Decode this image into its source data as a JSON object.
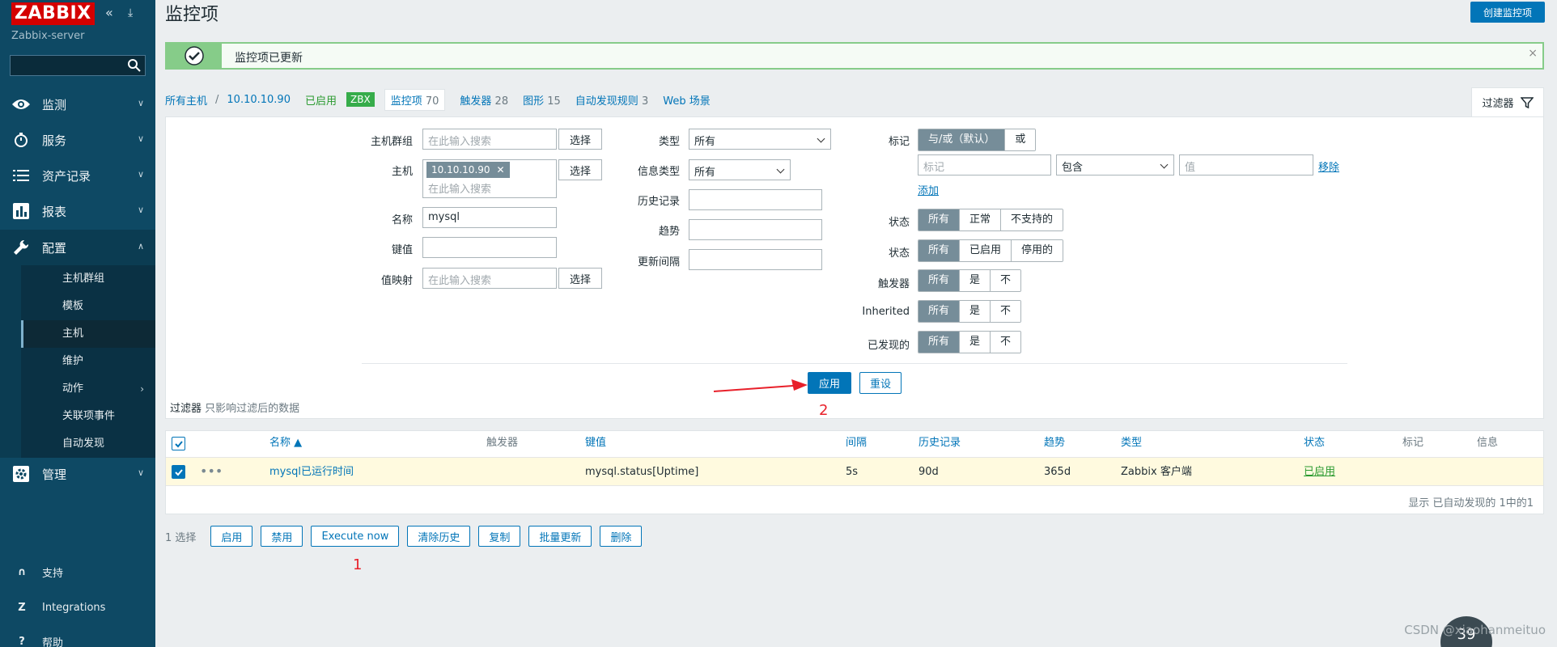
{
  "sidebar": {
    "logo": "ZABBIX",
    "server": "Zabbix-server",
    "search_placeholder": "",
    "nav": [
      {
        "label": "监测",
        "icon": "eye-icon"
      },
      {
        "label": "服务",
        "icon": "clock-icon"
      },
      {
        "label": "资产记录",
        "icon": "list-icon"
      },
      {
        "label": "报表",
        "icon": "chart-icon"
      },
      {
        "label": "配置",
        "icon": "wrench-icon"
      },
      {
        "label": "管理",
        "icon": "gear-icon"
      }
    ],
    "sub": [
      "主机群组",
      "模板",
      "主机",
      "维护",
      "动作",
      "关联项事件",
      "自动发现"
    ],
    "bottom": [
      {
        "label": "支持",
        "icon": "headset-icon"
      },
      {
        "label": "Integrations",
        "icon": "z-icon"
      },
      {
        "label": "帮助",
        "icon": "help-icon"
      }
    ]
  },
  "header": {
    "title": "监控项",
    "create_button": "创建监控项"
  },
  "message": {
    "text": "监控项已更新",
    "close": "×"
  },
  "tabs": {
    "all_hosts": "所有主机",
    "sep": "/",
    "host": "10.10.10.90",
    "enabled": "已启用",
    "zbx": "ZBX",
    "items": "监控项",
    "items_count": "70",
    "triggers": "触发器",
    "triggers_count": "28",
    "graphs": "图形",
    "graphs_count": "15",
    "discovery": "自动发现规则",
    "discovery_count": "3",
    "web": "Web 场景",
    "filter": "过滤器"
  },
  "filter": {
    "host_group_label": "主机群组",
    "host_group_placeholder": "在此输入搜索",
    "select": "选择",
    "host_label": "主机",
    "host_tag": "10.10.10.90",
    "host_placeholder": "在此输入搜索",
    "name_label": "名称",
    "name_value": "mysql",
    "key_label": "键值",
    "key_value": "",
    "valuemap_label": "值映射",
    "valuemap_placeholder": "在此输入搜索",
    "type_label": "类型",
    "type_value": "所有",
    "info_type_label": "信息类型",
    "info_type_value": "所有",
    "history_label": "历史记录",
    "trends_label": "趋势",
    "interval_label": "更新间隔",
    "tags_label": "标记",
    "tags_andor": "与/或（默认）",
    "tags_or": "或",
    "tag_placeholder": "标记",
    "tag_op": "包含",
    "tag_value_placeholder": "值",
    "remove": "移除",
    "add": "添加",
    "state_label": "状态",
    "state_opts": [
      "所有",
      "正常",
      "不支持的"
    ],
    "status_label": "状态",
    "status_opts": [
      "所有",
      "已启用",
      "停用的"
    ],
    "triggers_label": "触发器",
    "yn_opts": [
      "所有",
      "是",
      "不"
    ],
    "inherited_label": "Inherited",
    "discovered_label": "已发现的",
    "apply": "应用",
    "reset": "重设",
    "note_bold": "过滤器",
    "note": "只影响过滤后的数据"
  },
  "annotations": {
    "one": "1",
    "two": "2"
  },
  "table": {
    "headers": [
      "名称 ▲",
      "触发器",
      "键值",
      "间隔",
      "历史记录",
      "趋势",
      "类型",
      "状态",
      "标记",
      "信息"
    ],
    "rows": [
      {
        "name": "mysql已运行时间",
        "key": "mysql.status[Uptime]",
        "interval": "5s",
        "history": "90d",
        "trends": "365d",
        "type": "Zabbix 客户端",
        "status": "已启用"
      }
    ],
    "footer": "显示 已自动发现的 1中的1"
  },
  "actions": {
    "count": "1 选择",
    "buttons": [
      "启用",
      "禁用",
      "Execute now",
      "清除历史",
      "复制",
      "批量更新",
      "删除"
    ]
  },
  "watermark": "CSDN @xiaohanmeituo",
  "gauge": "39",
  "colors": {
    "sidebar": "#0e4964",
    "accent": "#0275b8",
    "success": "#86cc89",
    "logo": "#d40000"
  }
}
